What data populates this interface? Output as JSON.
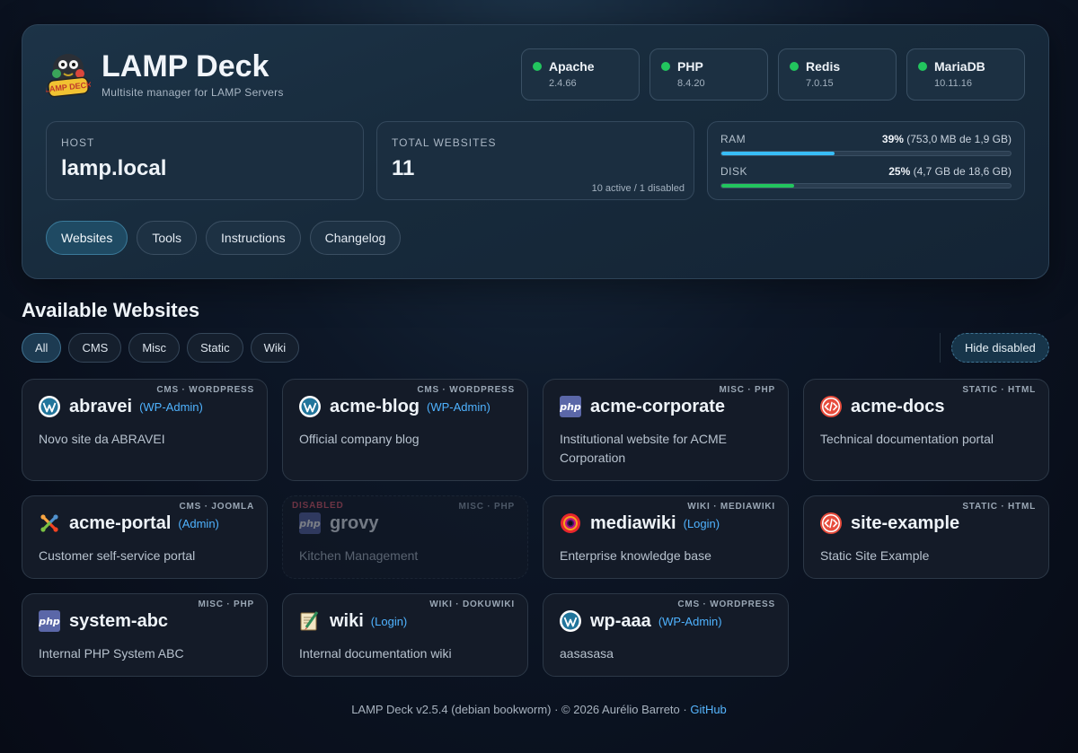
{
  "app": {
    "title": "LAMP Deck",
    "subtitle": "Multisite manager for LAMP Servers",
    "logo_text": "LAMP DECK"
  },
  "services": [
    {
      "name": "Apache",
      "version": "2.4.66",
      "status_color": "#22c55e"
    },
    {
      "name": "PHP",
      "version": "8.4.20",
      "status_color": "#22c55e"
    },
    {
      "name": "Redis",
      "version": "7.0.15",
      "status_color": "#22c55e"
    },
    {
      "name": "MariaDB",
      "version": "10.11.16",
      "status_color": "#22c55e"
    }
  ],
  "host": {
    "label": "HOST",
    "value": "lamp.local"
  },
  "total": {
    "label": "TOTAL WEBSITES",
    "value": "11",
    "foot": "10 active / 1 disabled"
  },
  "resources": {
    "ram": {
      "label": "RAM",
      "percent_text": "39%",
      "detail": "(753,0 MB de 1,9 GB)",
      "fraction": 0.39,
      "color": "#38bdf8"
    },
    "disk": {
      "label": "DISK",
      "percent_text": "25%",
      "detail": "(4,7 GB de 18,6 GB)",
      "fraction": 0.25,
      "color": "#22c55e"
    }
  },
  "tabs": [
    "Websites",
    "Tools",
    "Instructions",
    "Changelog"
  ],
  "section_title": "Available Websites",
  "filters": [
    "All",
    "CMS",
    "Misc",
    "Static",
    "Wiki"
  ],
  "hide_disabled": "Hide disabled",
  "disabled_label": "DISABLED",
  "sites": [
    {
      "name": "abravei",
      "tag": "CMS · WORDPRESS",
      "link": "(WP-Admin)",
      "desc": "Novo site da ABRAVEI",
      "icon": "wordpress-icon",
      "disabled": false
    },
    {
      "name": "acme-blog",
      "tag": "CMS · WORDPRESS",
      "link": "(WP-Admin)",
      "desc": "Official company blog",
      "icon": "wordpress-icon",
      "disabled": false
    },
    {
      "name": "acme-corporate",
      "tag": "MISC · PHP",
      "link": "",
      "desc": "Institutional website for ACME Corporation",
      "icon": "php-icon",
      "disabled": false
    },
    {
      "name": "acme-docs",
      "tag": "STATIC · HTML",
      "link": "",
      "desc": "Technical documentation portal",
      "icon": "html-code-icon",
      "disabled": false
    },
    {
      "name": "acme-portal",
      "tag": "CMS · JOOMLA",
      "link": "(Admin)",
      "desc": "Customer self-service portal",
      "icon": "joomla-icon",
      "disabled": false
    },
    {
      "name": "grovy",
      "tag": "MISC · PHP",
      "link": "",
      "desc": "Kitchen Management",
      "icon": "php-icon",
      "disabled": true
    },
    {
      "name": "mediawiki",
      "tag": "WIKI · MEDIAWIKI",
      "link": "(Login)",
      "desc": "Enterprise knowledge base",
      "icon": "mediawiki-icon",
      "disabled": false
    },
    {
      "name": "site-example",
      "tag": "STATIC · HTML",
      "link": "",
      "desc": "Static Site Example",
      "icon": "html-code-icon",
      "disabled": false
    },
    {
      "name": "system-abc",
      "tag": "MISC · PHP",
      "link": "",
      "desc": "Internal PHP System ABC",
      "icon": "php-icon",
      "disabled": false
    },
    {
      "name": "wiki",
      "tag": "WIKI · DOKUWIKI",
      "link": "(Login)",
      "desc": "Internal documentation wiki",
      "icon": "dokuwiki-icon",
      "disabled": false
    },
    {
      "name": "wp-aaa",
      "tag": "CMS · WORDPRESS",
      "link": "(WP-Admin)",
      "desc": "aasasasa",
      "icon": "wordpress-icon",
      "disabled": false
    }
  ],
  "footer": {
    "text": "LAMP Deck v2.5.4 (debian bookworm) · © 2026 Aurélio Barreto · ",
    "link": "GitHub"
  }
}
